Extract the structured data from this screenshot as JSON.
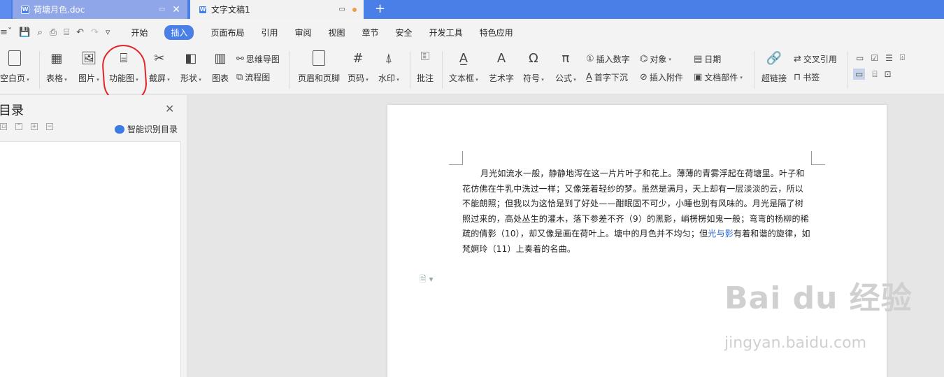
{
  "tabs": [
    {
      "label": "荷塘月色.doc"
    },
    {
      "label": "文字文稿1"
    }
  ],
  "menu": {
    "items": [
      "开始",
      "插入",
      "页面布局",
      "引用",
      "审阅",
      "视图",
      "章节",
      "安全",
      "开发工具",
      "特色应用"
    ],
    "active": "插入"
  },
  "ribbon": {
    "blank_page": "空白页",
    "table": "表格",
    "picture": "图片",
    "function_chart": "功能图",
    "screenshot": "截屏",
    "shape": "形状",
    "chart": "图表",
    "mindmap": "思维导图",
    "flowchart": "流程图",
    "header_footer": "页眉和页脚",
    "page_number": "页码",
    "watermark": "水印",
    "comment": "批注",
    "textbox": "文本框",
    "wordart": "艺术字",
    "symbol": "符号",
    "formula": "公式",
    "insert_number": "插入数字",
    "object": "对象",
    "date": "日期",
    "dropcap": "首字下沉",
    "attachment": "插入附件",
    "doc_parts": "文档部件",
    "hyperlink": "超链接",
    "cross_ref": "交叉引用",
    "bookmark": "书签"
  },
  "nav": {
    "title": "目录",
    "smart_label": "智能识别目录"
  },
  "document": {
    "para_before_link": "月光如流水一般，静静地泻在这一片片叶子和花上。薄薄的青雾浮起在荷塘里。叶子和花仿佛在牛乳中洗过一样；又像笼着轻纱的梦。虽然是满月，天上却有一层淡淡的云，所以不能朗照；但我以为这恰是到了好处——酣眠固不可少，小睡也别有风味的。月光是隔了树照过来的，高处丛生的灌木，落下参差不齐（9）的黑影，峭楞楞如鬼一般；弯弯的杨柳的稀疏的倩影（10），却又像是画在荷叶上。塘中的月色并不均匀；但",
    "link": "光与影",
    "para_after_link": "有着和谐的旋律，如梵婀玲（11）上奏着的名曲。"
  },
  "watermark": {
    "brand": "Bai du 经验",
    "url": "jingyan.baidu.com"
  }
}
